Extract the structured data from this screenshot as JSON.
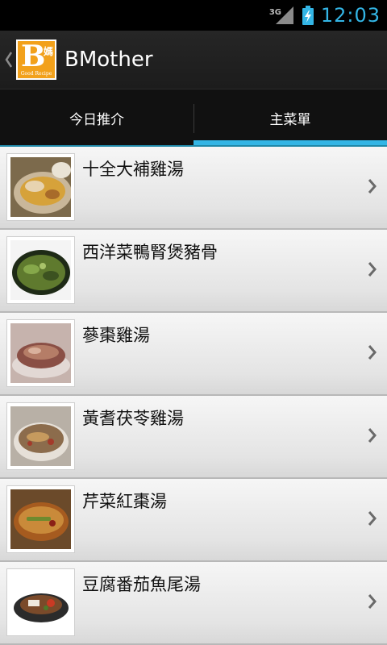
{
  "status_bar": {
    "network": "3G",
    "time": "12:03",
    "colors": {
      "clock": "#33b5e5"
    },
    "icons": [
      "signal-icon",
      "battery-charging-icon"
    ]
  },
  "action_bar": {
    "title": "BMother",
    "logo_letter": "B",
    "logo_char": "媽",
    "logo_sub": "Good Recipe",
    "icons": [
      "up-chevron-icon",
      "app-logo-icon"
    ]
  },
  "tabs": [
    {
      "label": "今日推介",
      "selected": false
    },
    {
      "label": "主菜單",
      "selected": true
    }
  ],
  "accent_color": "#33b5e5",
  "recipes": [
    {
      "name": "十全大補雞湯",
      "thumb": "soup-thumbnail"
    },
    {
      "name": "西洋菜鴨腎煲豬骨",
      "thumb": "soup-thumbnail"
    },
    {
      "name": "蔘棗雞湯",
      "thumb": "soup-thumbnail"
    },
    {
      "name": "黃耆茯苓雞湯",
      "thumb": "soup-thumbnail"
    },
    {
      "name": "芹菜紅棗湯",
      "thumb": "soup-thumbnail"
    },
    {
      "name": "豆腐番茄魚尾湯",
      "thumb": "soup-thumbnail"
    }
  ]
}
